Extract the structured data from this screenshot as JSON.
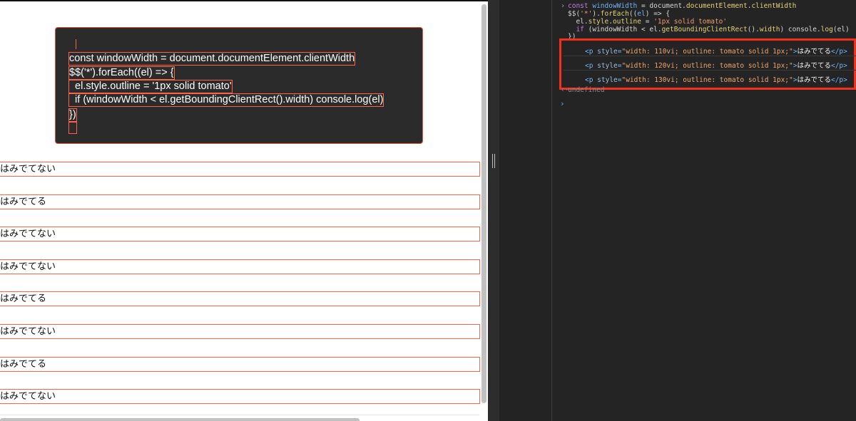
{
  "page": {
    "code_lines": [
      "const windowWidth = document.documentElement.clientWidth",
      "$$('*').forEach((el) => {",
      "  el.style.outline = '1px solid tomato'",
      "  if (windowWidth < el.getBoundingClientRect().width) console.log(el)",
      "})"
    ],
    "paragraphs": [
      "はみでてない",
      "はみでてる",
      "はみでてない",
      "はみでてない",
      "はみでてる",
      "はみでてない",
      "はみでてる",
      "はみでてない"
    ]
  },
  "console": {
    "input_lines": [
      "const windowWidth = document.documentElement.clientWidth",
      "$$('*').forEach((el) => {",
      "  el.style.outline = '1px solid tomato'",
      "  if (windowWidth < el.getBoundingClientRect().width) console.log(el)",
      "})"
    ],
    "results": [
      {
        "open": "<p ",
        "attr_name": "style",
        "attr_value": "\"width: 110vi; outline: tomato solid 1px;\"",
        "text": "はみでてる",
        "close": "</p>"
      },
      {
        "open": "<p ",
        "attr_name": "style",
        "attr_value": "\"width: 120vi; outline: tomato solid 1px;\"",
        "text": "はみでてる",
        "close": "</p>"
      },
      {
        "open": "<p ",
        "attr_name": "style",
        "attr_value": "\"width: 130vi; outline: tomato solid 1px;\"",
        "text": "はみでてる",
        "close": "</p>"
      }
    ],
    "return_value": "undefined"
  },
  "colors": {
    "outline": "#ff6347",
    "highlight_box": "#f2301b",
    "code_bg": "#2b2b2b",
    "console_bg": "#242424"
  },
  "icons": [
    "prompt-chevron-icon",
    "return-arrow-icon",
    "splitter-grip-icon"
  ]
}
